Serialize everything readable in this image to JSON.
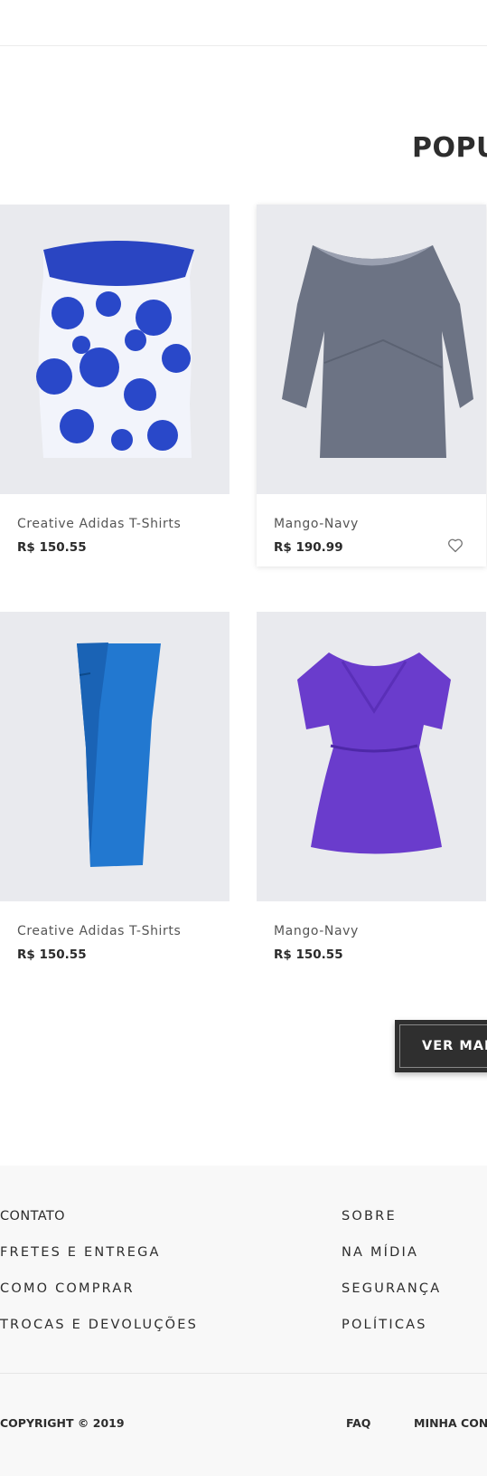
{
  "section": {
    "title": "POPU"
  },
  "products": [
    {
      "name": "Creative Adidas T-Shirts",
      "price": "R$ 150.55"
    },
    {
      "name": "Mango-Navy",
      "price": "R$ 190.99"
    },
    {
      "name": "Creative Adidas T-Shirts",
      "price": "R$ 150.55"
    },
    {
      "name": "Mango-Navy",
      "price": "R$ 150.55"
    }
  ],
  "more_button": {
    "label": "VER MAIS"
  },
  "footer": {
    "left_links": [
      "CONTATO",
      "FRETES E ENTREGA",
      "COMO COMPRAR",
      "TROCAS E DEVOLUÇÕES"
    ],
    "right_links": [
      "SOBRE",
      "NA MÍDIA",
      "SEGURANÇA",
      "POLÍTICAS"
    ],
    "copyright": "COPYRIGHT © 2019",
    "bottom_links": [
      "FAQ",
      "MINHA CONT"
    ]
  },
  "icons": {
    "wishlist": "heart-outline-icon"
  },
  "colors": {
    "accent_dark": "#2f2f2f",
    "image_bg": "#e9eaee",
    "footer_bg": "#f8f8f8"
  }
}
